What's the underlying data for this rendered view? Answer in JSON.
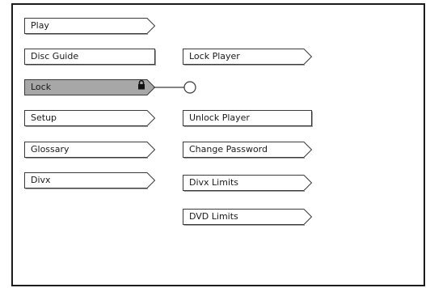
{
  "menu": {
    "left": [
      {
        "label": "Play",
        "shape": "arrow"
      },
      {
        "label": "Disc Guide",
        "shape": "rect"
      },
      {
        "label": "Lock",
        "shape": "arrow",
        "selected": true,
        "icon": "lock-icon"
      },
      {
        "label": "Setup",
        "shape": "arrow"
      },
      {
        "label": "Glossary",
        "shape": "arrow"
      },
      {
        "label": "Divx",
        "shape": "arrow"
      }
    ],
    "right": [
      {
        "label": "Lock Player",
        "shape": "arrow"
      },
      {
        "label": "Unlock Player",
        "shape": "rect"
      },
      {
        "label": "Change Password",
        "shape": "arrow"
      },
      {
        "label": "Divx Limits",
        "shape": "arrow"
      },
      {
        "label": "DVD Limits",
        "shape": "arrow"
      }
    ]
  },
  "colors": {
    "border": "#1c1c1c",
    "button_outline": "#3a3a3a",
    "selected_fill": "#a7a7a7",
    "button_fill": "#ffffff"
  }
}
